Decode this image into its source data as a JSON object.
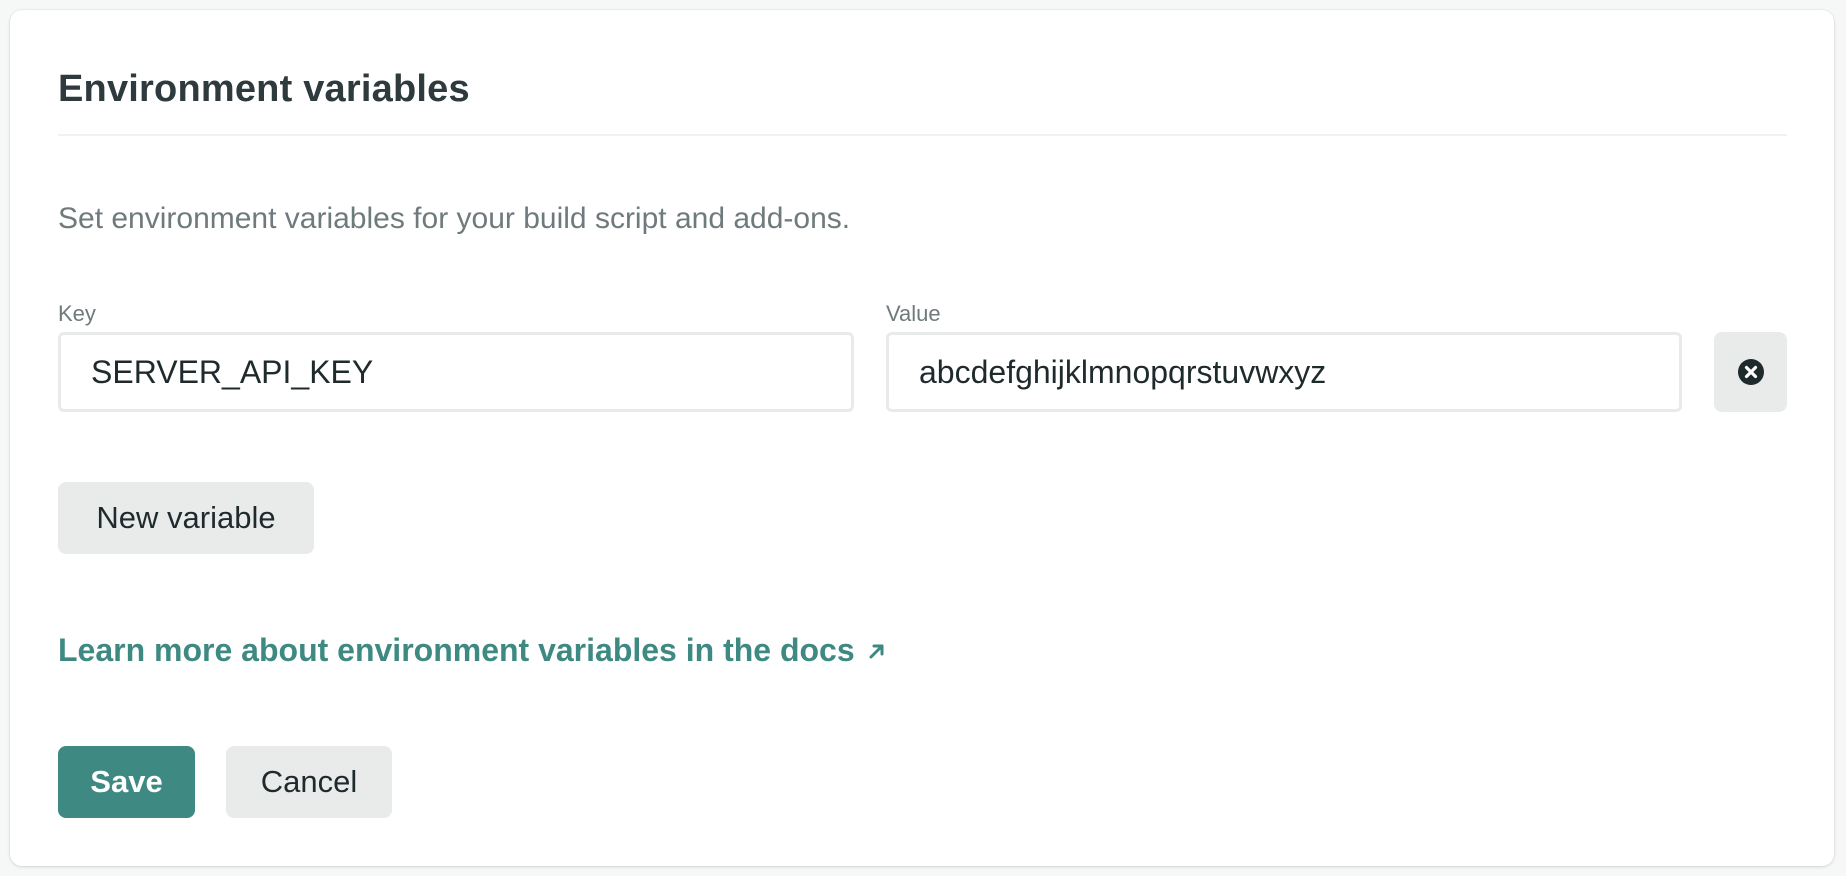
{
  "card": {
    "title": "Environment variables",
    "description": "Set environment variables for your build script and add-ons."
  },
  "variables": [
    {
      "key_label": "Key",
      "key_value": "SERVER_API_KEY",
      "value_label": "Value",
      "value_value": "abcdefghijklmnopqrstuvwxyz",
      "remove_icon": "close-circle-icon"
    }
  ],
  "actions": {
    "new_variable_label": "New variable",
    "docs_link_text": "Learn more about environment variables in the docs",
    "docs_link_icon": "arrow-up-right-icon",
    "save_label": "Save",
    "cancel_label": "Cancel"
  },
  "colors": {
    "accent": "#3e8a82",
    "title": "#2e3a3d",
    "muted_text": "#6f7a7d",
    "button_secondary_bg": "#e9ebeb"
  }
}
